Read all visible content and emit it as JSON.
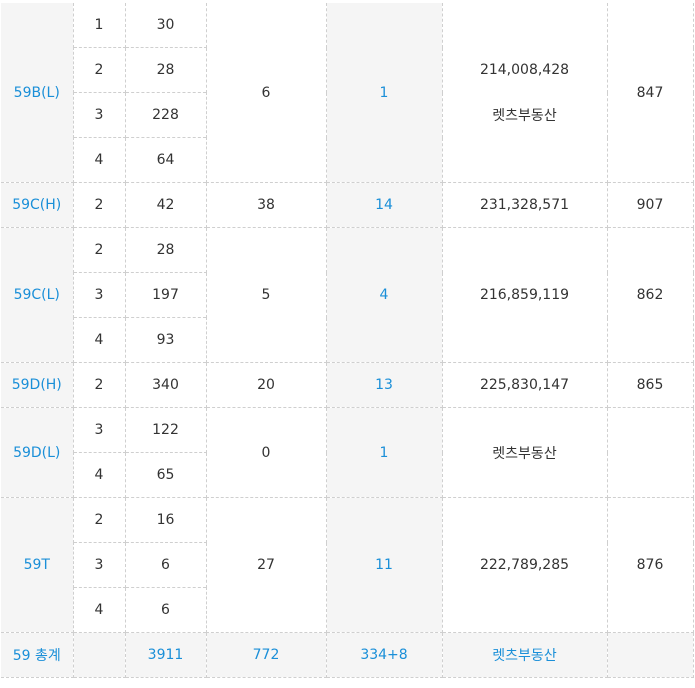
{
  "rows": {
    "b59l": {
      "type": "59B(L)",
      "floors": [
        {
          "floor": "1",
          "count": "30"
        },
        {
          "floor": "2",
          "count": "28"
        },
        {
          "floor": "3",
          "count": "228"
        },
        {
          "floor": "4",
          "count": "64"
        }
      ],
      "c4": "6",
      "c5": "1",
      "price": "214,008,428",
      "agent": "렛츠부동산",
      "last": "847"
    },
    "c59h": {
      "type": "59C(H)",
      "floors": [
        {
          "floor": "2",
          "count": "42"
        }
      ],
      "c4": "38",
      "c5": "14",
      "price": "231,328,571",
      "last": "907"
    },
    "c59l": {
      "type": "59C(L)",
      "floors": [
        {
          "floor": "2",
          "count": "28"
        },
        {
          "floor": "3",
          "count": "197"
        },
        {
          "floor": "4",
          "count": "93"
        }
      ],
      "c4": "5",
      "c5": "4",
      "price": "216,859,119",
      "last": "862"
    },
    "d59h": {
      "type": "59D(H)",
      "floors": [
        {
          "floor": "2",
          "count": "340"
        }
      ],
      "c4": "20",
      "c5": "13",
      "price": "225,830,147",
      "last": "865"
    },
    "d59l": {
      "type": "59D(L)",
      "floors": [
        {
          "floor": "3",
          "count": "122"
        },
        {
          "floor": "4",
          "count": "65"
        }
      ],
      "c4": "0",
      "c5": "1",
      "agent": "렛츠부동산"
    },
    "t59": {
      "type": "59T",
      "floors": [
        {
          "floor": "2",
          "count": "16"
        },
        {
          "floor": "3",
          "count": "6"
        },
        {
          "floor": "4",
          "count": "6"
        }
      ],
      "c4": "27",
      "c5": "11",
      "price": "222,789,285",
      "last": "876"
    },
    "total": {
      "label": "59 총계",
      "count": "3911",
      "c4": "772",
      "c5": "334+8",
      "agent": "렛츠부동산"
    }
  },
  "colors": {
    "accent": "#1a8fd8",
    "header_bg": "#f5f5f5",
    "border": "#cfcfcf",
    "text": "#333333"
  }
}
